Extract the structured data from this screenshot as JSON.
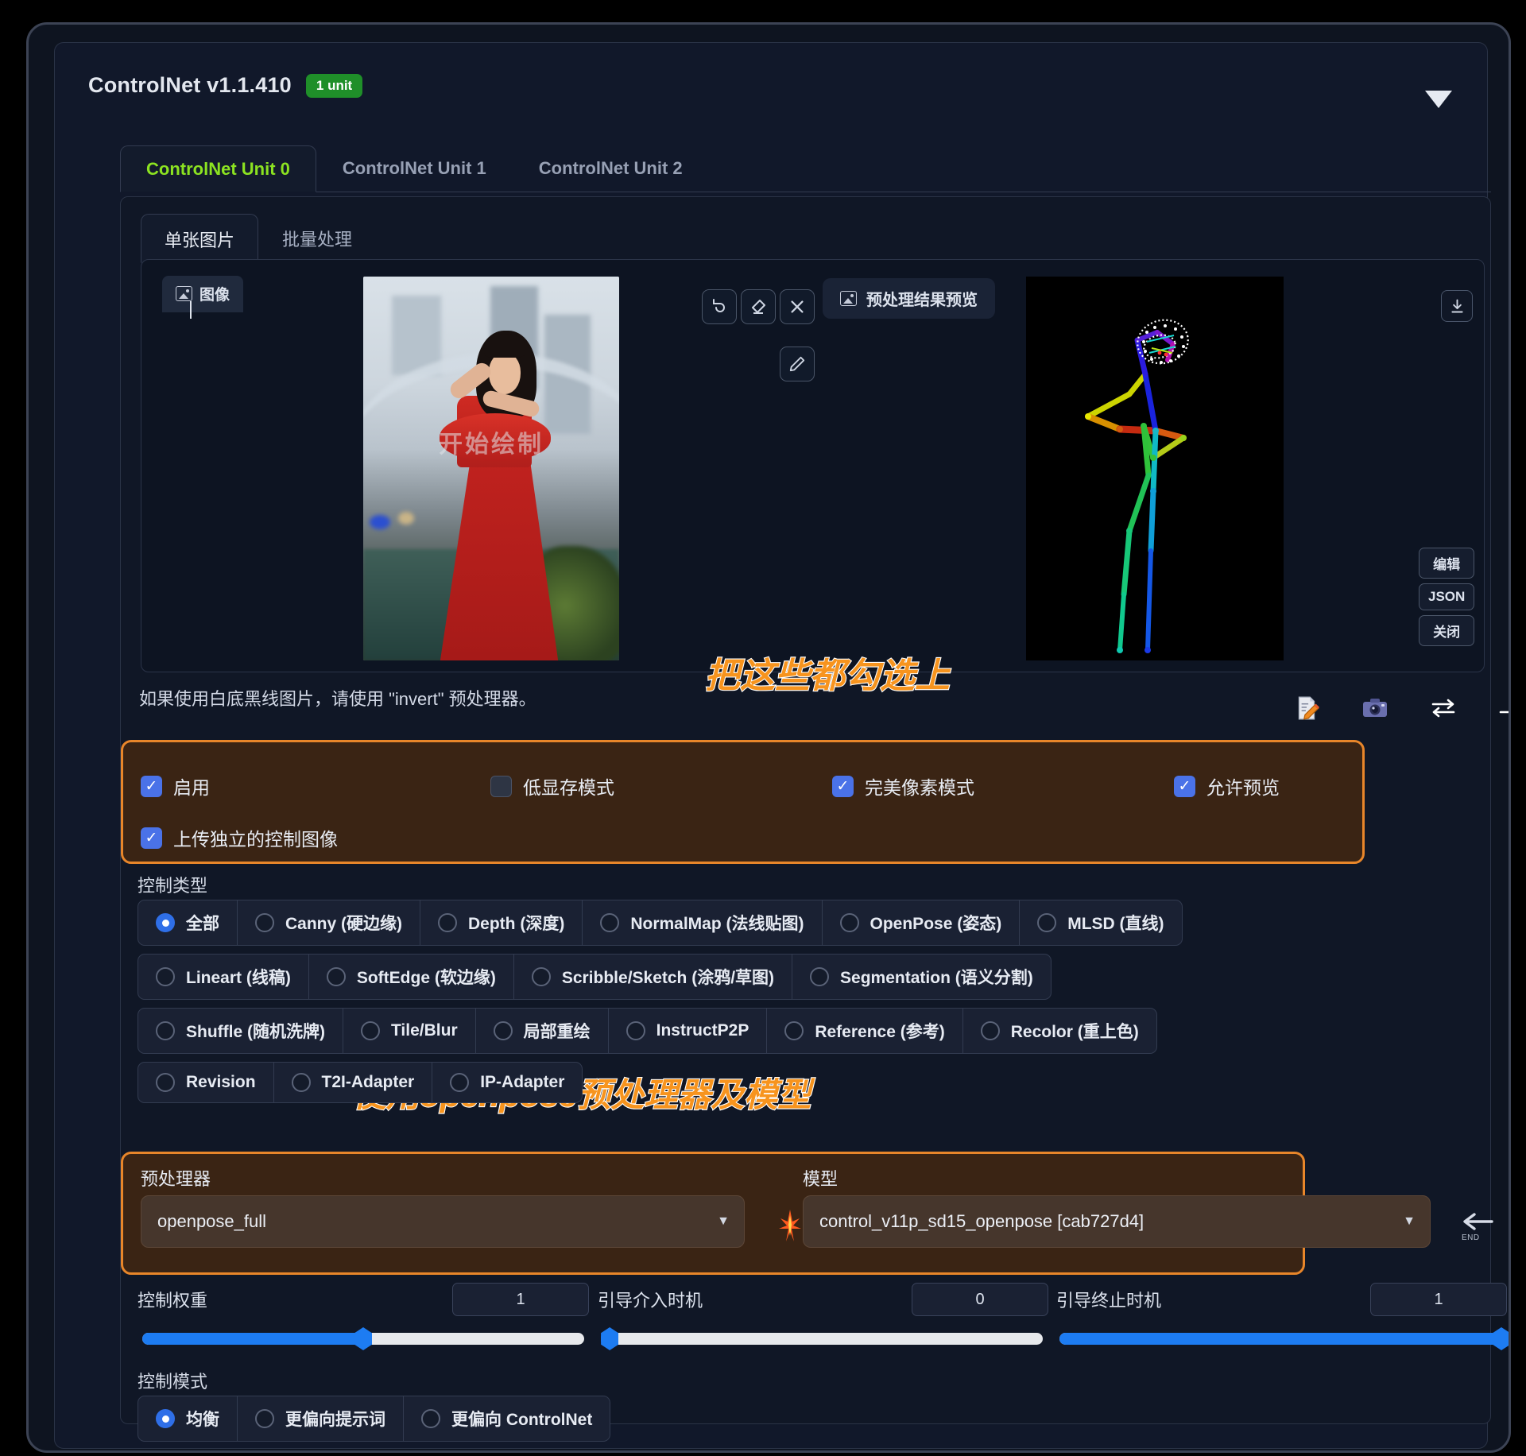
{
  "header": {
    "title": "ControlNet v1.1.410",
    "badge": "1 unit",
    "collapse_icon": "chevron-down-icon",
    "accent_green": "#8ce321",
    "badge_green": "#1f8f29",
    "annotation_orange": "#f7941e"
  },
  "unit_tabs": [
    {
      "label": "ControlNet Unit 0",
      "active": true
    },
    {
      "label": "ControlNet Unit 1",
      "active": false
    },
    {
      "label": "ControlNet Unit 2",
      "active": false
    }
  ],
  "mode_tabs": [
    {
      "label": "单张图片",
      "active": true
    },
    {
      "label": "批量处理",
      "active": false
    }
  ],
  "workspace": {
    "image_tab_label": "图像",
    "preview_tab_label": "预处理结果预览",
    "source_watermark": "开始绘制",
    "tools": [
      {
        "name": "undo-icon",
        "glyph": "↺"
      },
      {
        "name": "eraser-icon",
        "glyph": "⬙"
      },
      {
        "name": "clear-icon",
        "glyph": "✕"
      },
      {
        "name": "pen-icon",
        "glyph": "✎"
      }
    ],
    "download_icon": "download-icon",
    "side_buttons": [
      {
        "label": "编辑"
      },
      {
        "label": "JSON"
      },
      {
        "label": "关闭"
      }
    ]
  },
  "hint": "如果使用白底黑线图片，请使用 \"invert\" 预处理器。",
  "annotations": [
    {
      "text": "把这些都勾选上"
    },
    {
      "text": "使用openpose预处理器及模型"
    }
  ],
  "right_icons": [
    {
      "name": "edit-note-icon",
      "glyph": "📝"
    },
    {
      "name": "camera-icon",
      "glyph": "📷"
    },
    {
      "name": "swap-icon",
      "glyph": "⇄"
    },
    {
      "name": "send-icon",
      "glyph": "↱"
    }
  ],
  "checkboxes": [
    {
      "label": "启用",
      "checked": true
    },
    {
      "label": "低显存模式",
      "checked": false
    },
    {
      "label": "完美像素模式",
      "checked": true
    },
    {
      "label": "允许预览",
      "checked": true
    },
    {
      "label": "上传独立的控制图像",
      "checked": true
    }
  ],
  "control_type": {
    "label": "控制类型",
    "rows": [
      [
        {
          "label": "全部",
          "selected": true
        },
        {
          "label": "Canny (硬边缘)",
          "selected": false
        },
        {
          "label": "Depth (深度)",
          "selected": false
        },
        {
          "label": "NormalMap (法线贴图)",
          "selected": false
        },
        {
          "label": "OpenPose (姿态)",
          "selected": false
        },
        {
          "label": "MLSD (直线)",
          "selected": false
        }
      ],
      [
        {
          "label": "Lineart (线稿)",
          "selected": false
        },
        {
          "label": "SoftEdge (软边缘)",
          "selected": false
        },
        {
          "label": "Scribble/Sketch (涂鸦/草图)",
          "selected": false
        },
        {
          "label": "Segmentation (语义分割)",
          "selected": false
        }
      ],
      [
        {
          "label": "Shuffle (随机洗牌)",
          "selected": false
        },
        {
          "label": "Tile/Blur",
          "selected": false
        },
        {
          "label": "局部重绘",
          "selected": false
        },
        {
          "label": "InstructP2P",
          "selected": false
        },
        {
          "label": "Reference (参考)",
          "selected": false
        },
        {
          "label": "Recolor (重上色)",
          "selected": false
        }
      ],
      [
        {
          "label": "Revision",
          "selected": false
        },
        {
          "label": "T2I-Adapter",
          "selected": false
        },
        {
          "label": "IP-Adapter",
          "selected": false
        }
      ]
    ]
  },
  "preprocessor": {
    "label": "预处理器",
    "value": "openpose_full"
  },
  "model": {
    "label": "模型",
    "value": "control_v11p_sd15_openpose [cab727d4]"
  },
  "spark_icon": "spark-icon",
  "end_arrow_label": "END",
  "sliders": [
    {
      "label": "控制权重",
      "value": "1",
      "percent": 50
    },
    {
      "label": "引导介入时机",
      "value": "0",
      "percent": 2
    },
    {
      "label": "引导终止时机",
      "value": "1",
      "percent": 100
    }
  ],
  "control_mode": {
    "label": "控制模式",
    "options": [
      {
        "label": "均衡",
        "selected": true
      },
      {
        "label": "更偏向提示词",
        "selected": false
      },
      {
        "label": "更偏向 ControlNet",
        "selected": false
      }
    ]
  }
}
